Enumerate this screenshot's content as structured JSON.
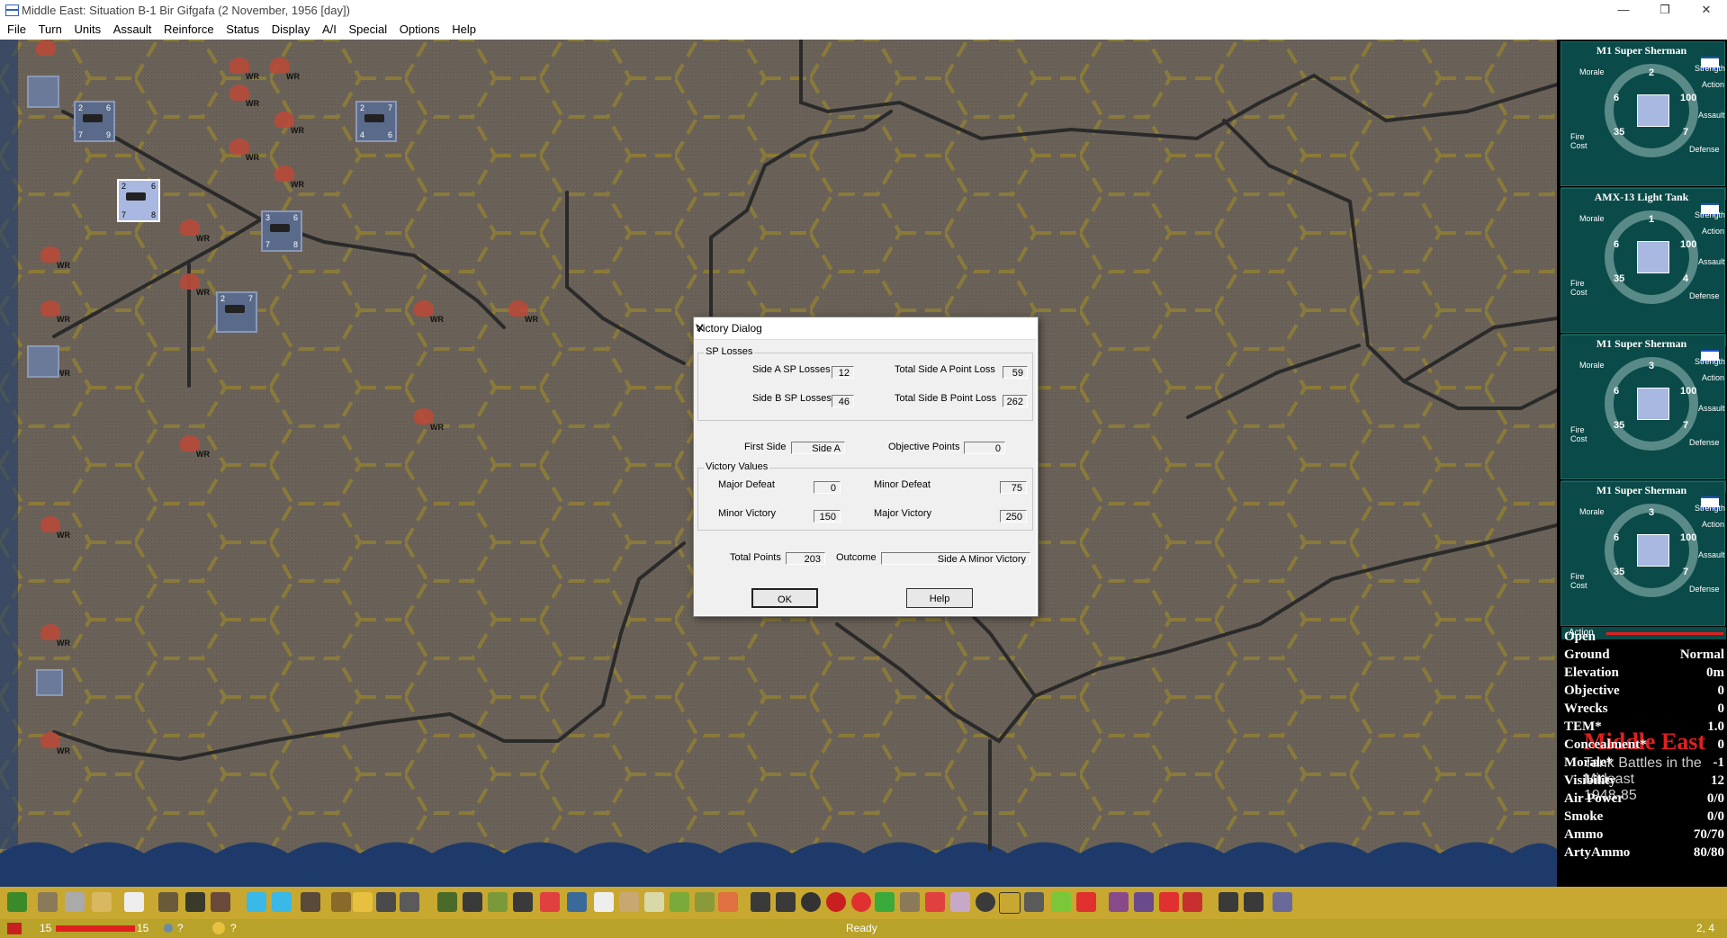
{
  "window": {
    "title": "Middle East: Situation B-1 Bir Gifgafa (2 November, 1956 [day])",
    "controls": [
      "—",
      "❐",
      "✕"
    ]
  },
  "menu": [
    "File",
    "Turn",
    "Units",
    "Assault",
    "Reinforce",
    "Status",
    "Display",
    "A/I",
    "Special",
    "Options",
    "Help"
  ],
  "map": {
    "wreck_label": "WR",
    "units": [
      {
        "tl": "2",
        "tr": "6",
        "bl": "7",
        "br": "8"
      },
      {
        "tl": "2",
        "tr": "6",
        "bl": "7",
        "br": "9"
      },
      {
        "tl": "3",
        "tr": "6",
        "bl": "7",
        "br": "8"
      },
      {
        "tl": "2",
        "tr": "7",
        "bl": "4",
        "br": "6"
      },
      {
        "tl": "2",
        "tr": "7",
        "bl": "",
        "br": ""
      }
    ]
  },
  "dialog": {
    "title": "Victory Dialog",
    "close": "✕",
    "sp_losses": {
      "group": "SP Losses",
      "side_a_sp_losses_label": "Side A SP Losses",
      "side_a_sp_losses": "12",
      "side_b_sp_losses_label": "Side B SP Losses",
      "side_b_sp_losses": "46",
      "total_a_label": "Total Side A Point Loss",
      "total_a": "59",
      "total_b_label": "Total Side B Point Loss",
      "total_b": "262"
    },
    "first_side_label": "First Side",
    "first_side": "Side A",
    "objective_points_label": "Objective Points",
    "objective_points": "0",
    "victory_values": {
      "group": "Victory Values",
      "major_defeat_label": "Major Defeat",
      "major_defeat": "0",
      "minor_defeat_label": "Minor Defeat",
      "minor_defeat": "75",
      "minor_victory_label": "Minor Victory",
      "minor_victory": "150",
      "major_victory_label": "Major Victory",
      "major_victory": "250"
    },
    "total_points_label": "Total Points",
    "total_points": "203",
    "outcome_label": "Outcome",
    "outcome": "Side A Minor Victory",
    "ok": "OK",
    "help": "Help"
  },
  "unit_cards": [
    {
      "name": "M1 Super Sherman",
      "top": "2",
      "left": "6",
      "right": "100",
      "bl": "35",
      "br": "7"
    },
    {
      "name": "AMX-13 Light Tank",
      "top": "1",
      "left": "6",
      "right": "100",
      "bl": "35",
      "br": "4"
    },
    {
      "name": "M1 Super Sherman",
      "top": "3",
      "left": "6",
      "right": "100",
      "bl": "35",
      "br": "7"
    },
    {
      "name": "M1 Super Sherman",
      "top": "3",
      "left": "6",
      "right": "100",
      "bl": "35",
      "br": "7"
    }
  ],
  "card_labels": {
    "morale": "Morale",
    "strength": "Strength",
    "action": "Action",
    "assault": "Assault",
    "fire": "Fire",
    "cost": "Cost",
    "defense": "Defense",
    "action_bar": "Action"
  },
  "terrain": [
    {
      "label": "Open",
      "value": ""
    },
    {
      "label": "Ground",
      "value": "Normal"
    },
    {
      "label": "Elevation",
      "value": "0m"
    },
    {
      "label": "Objective",
      "value": "0"
    },
    {
      "label": "Wrecks",
      "value": "0"
    },
    {
      "label": "TEM*",
      "value": "1.0"
    },
    {
      "label": "Concealment*",
      "value": "0"
    },
    {
      "label": "Morale*",
      "value": "-1"
    },
    {
      "label": "Visibility",
      "value": "12"
    },
    {
      "label": "Air Power",
      "value": "0/0"
    },
    {
      "label": "Smoke",
      "value": "0/0"
    },
    {
      "label": "Ammo",
      "value": "70/70"
    },
    {
      "label": "ArtyAmmo",
      "value": "80/80"
    }
  ],
  "logo": {
    "line1": "Middle East",
    "line2": "Tank Battles in the Mideast",
    "line3": "1948-85"
  },
  "status": {
    "left_turn": "15",
    "right_turn": "15",
    "q1": "?",
    "q2": "?",
    "ready": "Ready",
    "coords": "2, 4"
  },
  "colors": {
    "map_bg": "#6a6258",
    "hex_grid": "#8a7a3a",
    "road": "#2a2a2a",
    "water": "#1e3a6a",
    "toolbar": "#c8a830",
    "panel_teal": "#0a4a48",
    "red": "#e02020"
  }
}
